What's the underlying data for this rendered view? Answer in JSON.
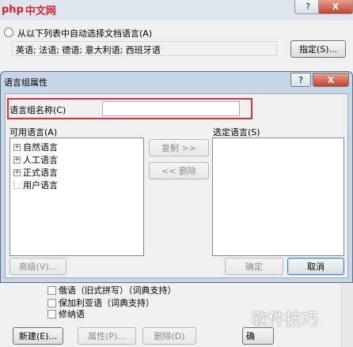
{
  "background": {
    "logo_text_a": "php",
    "logo_text_b": "中文网",
    "title_help": "?",
    "title_close": "X",
    "radio_label": "从以下列表中自动选择文档语言(A)",
    "languages": "英语; 法语; 德语; 意大利语; 西班牙语",
    "specify_button": "指定(S)...",
    "checkbox_items": [
      "俄语（旧式拼写）（词典支持）",
      "保加利亚语（词典支持）",
      "修纳语"
    ],
    "new_button": "新建(E)...",
    "properties_button": "属性(P)...",
    "delete_button": "删除(D)",
    "right_partial": "确"
  },
  "dialog": {
    "title": "语言组属性",
    "help": "?",
    "close": "X",
    "name_label": "语言组名称(C)",
    "name_value": "",
    "available_label": "可用语言(A)",
    "selected_label": "选定语言(S)",
    "tree": [
      {
        "label": "自然语言",
        "expandable": true
      },
      {
        "label": "人工语言",
        "expandable": true
      },
      {
        "label": "正式语言",
        "expandable": true
      },
      {
        "label": "用户语言",
        "expandable": false
      }
    ],
    "copy_button": "复制 >>",
    "remove_button": "<< 删除",
    "advanced_button": "高级(V)...",
    "ok_button": "确定",
    "cancel_button": "取消"
  },
  "watermark": "软件技巧"
}
